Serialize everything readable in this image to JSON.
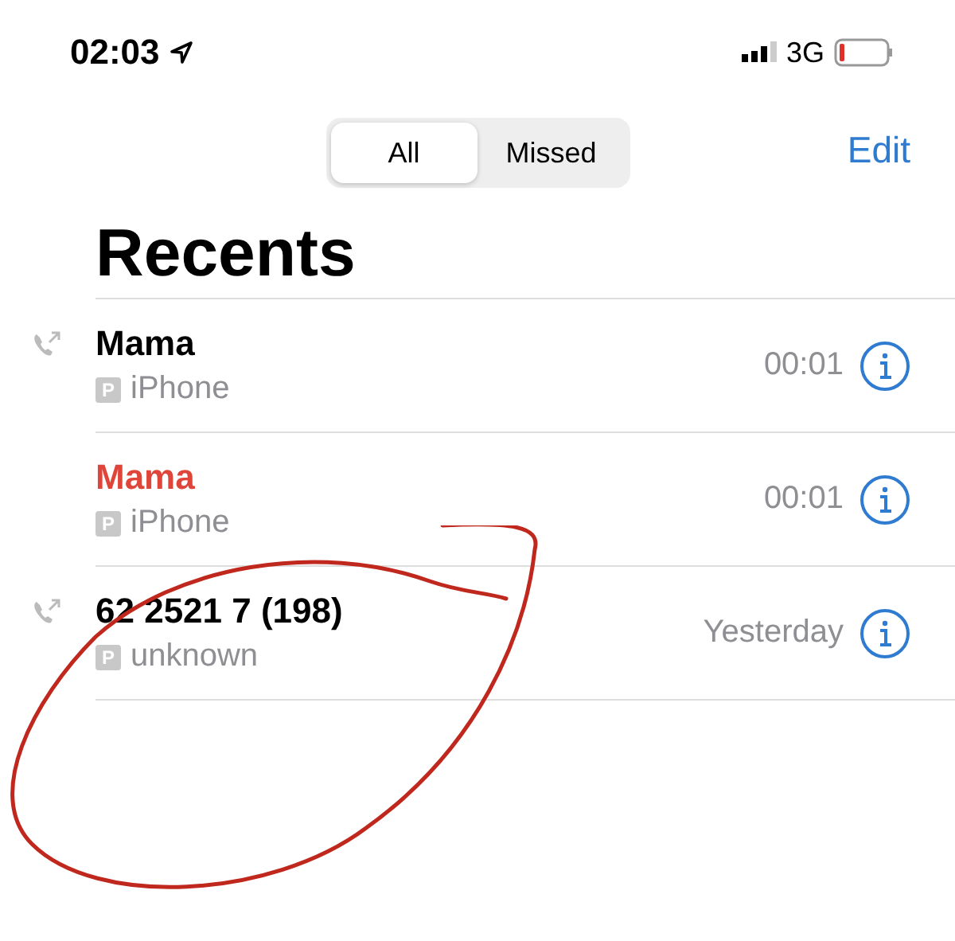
{
  "status_bar": {
    "time": "02:03",
    "network": "3G"
  },
  "tabs": [
    {
      "label": "All",
      "selected": true
    },
    {
      "label": "Missed",
      "selected": false
    }
  ],
  "edit_button": "Edit",
  "title": "Recents",
  "calls": [
    {
      "name": "Mama",
      "badge": "P",
      "type": "iPhone",
      "time": "00:01",
      "missed": false,
      "outgoing": true
    },
    {
      "name": "Mama",
      "badge": "P",
      "type": "iPhone",
      "time": "00:01",
      "missed": true,
      "outgoing": false
    },
    {
      "name": "62 2521 7 (198)",
      "badge": "P",
      "type": "unknown",
      "time": "Yesterday",
      "missed": false,
      "outgoing": true
    }
  ]
}
